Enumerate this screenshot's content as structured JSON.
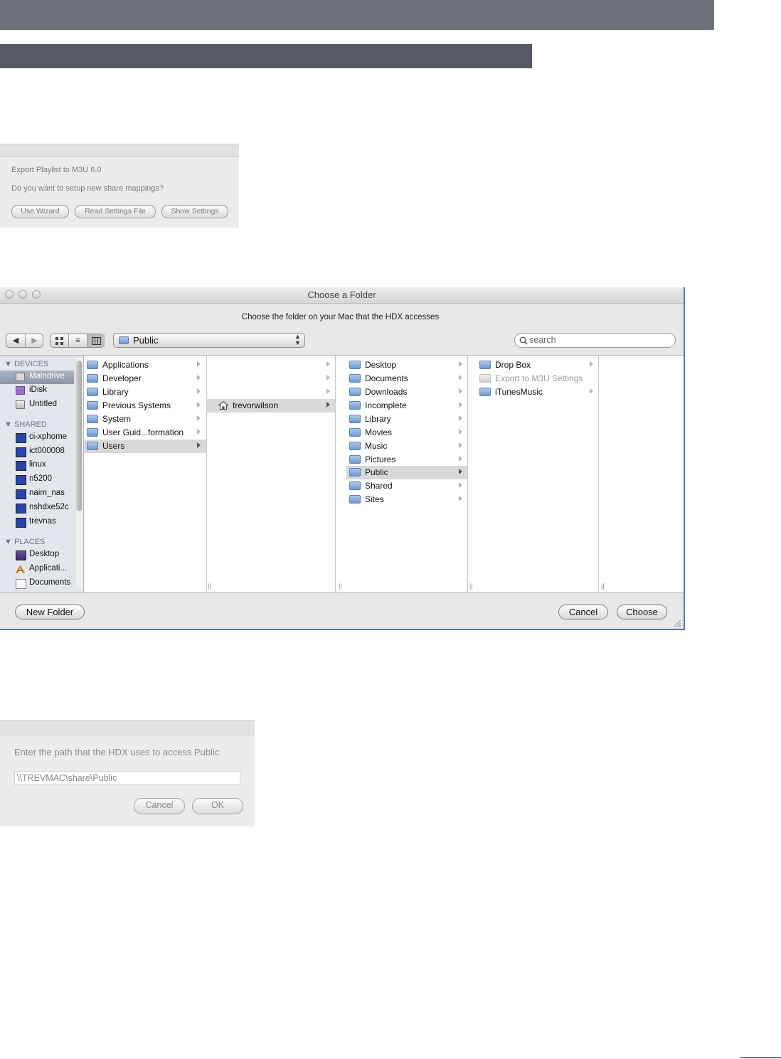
{
  "dialog_export": {
    "title": "Export Playlist to M3U 6.0",
    "question": "Do you want to setup new share mappings?",
    "buttons": [
      "Use Wizard",
      "Read Settings File",
      "Show Settings"
    ]
  },
  "finder_dialog": {
    "title": "Choose a Folder",
    "prompt": "Choose the folder on your Mac that the HDX accesses",
    "path_popup": "Public",
    "search_placeholder": "search",
    "sidebar": {
      "devices_header": "DEVICES",
      "devices": [
        "Maindrive",
        "iDisk",
        "Untitled"
      ],
      "selected_device": "Maindrive",
      "shared_header": "SHARED",
      "shared": [
        "ci-xphome",
        "ict000008",
        "linux",
        "n5200",
        "naim_nas",
        "nshdxe52c",
        "trevnas"
      ],
      "places_header": "PLACES",
      "places": [
        "Desktop",
        "Applicati...",
        "Documents"
      ]
    },
    "columns": [
      {
        "items": [
          "Applications",
          "Developer",
          "Library",
          "Previous Systems",
          "System",
          "User Guid...formation",
          "Users"
        ],
        "selected": "Users"
      },
      {
        "items": [
          "trevorwilson"
        ],
        "selected": "trevorwilson"
      },
      {
        "items": [
          "Desktop",
          "Documents",
          "Downloads",
          "Incomplete",
          "Library",
          "Movies",
          "Music",
          "Pictures",
          "Public",
          "Shared",
          "Sites"
        ],
        "selected": "Public"
      },
      {
        "items": [
          "Drop Box",
          "Export to M3U Settings",
          "iTunesMusic"
        ],
        "selected": ""
      }
    ],
    "buttons": {
      "new_folder": "New Folder",
      "cancel": "Cancel",
      "choose": "Choose"
    }
  },
  "dialog_path": {
    "prompt": "Enter the path that the HDX uses to access Public",
    "path_value": "\\\\TREVMAC\\share\\Public",
    "cancel": "Cancel",
    "ok": "OK"
  }
}
